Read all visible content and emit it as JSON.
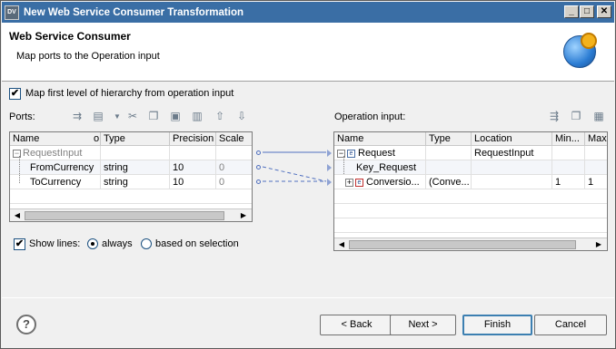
{
  "window": {
    "title": "New Web Service Consumer Transformation",
    "app_icon": "DV",
    "min": "_",
    "max": "□",
    "close": "✕"
  },
  "header": {
    "title": "Web Service Consumer",
    "subtitle": "Map ports to the Operation input",
    "icon": "globe-gear-icon"
  },
  "options": {
    "map_first_level": "Map first level of hierarchy from operation input",
    "map_first_level_checked": true,
    "show_lines": "Show lines:",
    "show_lines_checked": true,
    "radio_always": "always",
    "radio_on_selection": "based on selection",
    "selected_radio": "always"
  },
  "ports": {
    "label": "Ports:",
    "columns": [
      "Name",
      "Type",
      "Precision",
      "Scale"
    ],
    "name_col_marker": "o",
    "rows": [
      {
        "name": "RequestInput",
        "type": "",
        "precision": "",
        "scale": "",
        "group": true,
        "toggle": "−"
      },
      {
        "name": "FromCurrency",
        "type": "string",
        "precision": "10",
        "scale": "0"
      },
      {
        "name": "ToCurrency",
        "type": "string",
        "precision": "10",
        "scale": "0"
      }
    ]
  },
  "operation": {
    "label": "Operation input:",
    "columns": [
      "Name",
      "Type",
      "Location",
      "Min...",
      "Max"
    ],
    "rows": [
      {
        "name": "Request",
        "type": "",
        "location": "RequestInput",
        "min": "",
        "max": "",
        "toggle": "−"
      },
      {
        "name": "Key_Request",
        "type": "",
        "location": "",
        "min": "",
        "max": ""
      },
      {
        "name": "Conversio...",
        "type": "(Conve...",
        "location": "",
        "min": "1",
        "max": "1",
        "toggle": "+"
      }
    ]
  },
  "buttons": {
    "help": "?",
    "back": "< Back",
    "next": "Next >",
    "finish": "Finish",
    "cancel": "Cancel"
  },
  "colors": {
    "titlebar": "#3a6ea5",
    "link_line": "#4f6fbf",
    "default_button_border": "#3c7fb1"
  }
}
